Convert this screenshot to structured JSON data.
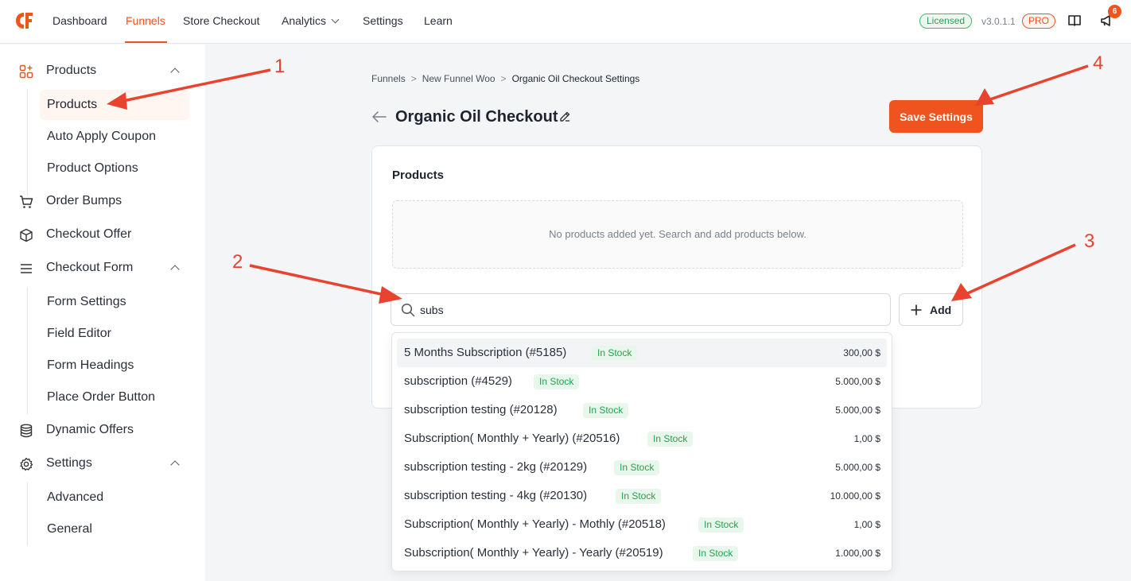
{
  "topnav": {
    "items": [
      {
        "label": "Dashboard"
      },
      {
        "label": "Funnels"
      },
      {
        "label": "Store Checkout"
      },
      {
        "label": "Analytics"
      },
      {
        "label": "Settings"
      },
      {
        "label": "Learn"
      }
    ],
    "licensed": "Licensed",
    "version": "v3.0.1.1",
    "pro": "PRO",
    "notifications": "6",
    "accent": "#f0541e"
  },
  "sidebar": {
    "groups": {
      "products": "Products",
      "order_bumps": "Order Bumps",
      "checkout_offer": "Checkout Offer",
      "checkout_form": "Checkout Form",
      "dynamic_offers": "Dynamic Offers",
      "settings": "Settings"
    },
    "products_sub": [
      "Products",
      "Auto Apply Coupon",
      "Product Options"
    ],
    "form_sub": [
      "Form Settings",
      "Field Editor",
      "Form Headings",
      "Place Order Button"
    ],
    "settings_sub": [
      "Advanced",
      "General"
    ]
  },
  "breadcrumb": [
    "Funnels",
    "New Funnel Woo",
    "Organic Oil Checkout Settings"
  ],
  "page_title": "Organic Oil Checkout",
  "save_label": "Save Settings",
  "card": {
    "title": "Products",
    "empty": "No products added yet. Search and add products below."
  },
  "search": {
    "value": "subs"
  },
  "add_label": "Add",
  "results": [
    {
      "name": "5 Months Subscription (#5185)",
      "stock": "In Stock",
      "price": "300,00 $"
    },
    {
      "name": "subscription (#4529)",
      "stock": "In Stock",
      "price": "5.000,00 $"
    },
    {
      "name": "subscription testing (#20128)",
      "stock": "In Stock",
      "price": "5.000,00 $"
    },
    {
      "name": "Subscription( Monthly + Yearly) (#20516)",
      "stock": "In Stock",
      "price": "1,00 $"
    },
    {
      "name": "subscription testing - 2kg (#20129)",
      "stock": "In Stock",
      "price": "5.000,00 $"
    },
    {
      "name": "subscription testing - 4kg (#20130)",
      "stock": "In Stock",
      "price": "10.000,00 $"
    },
    {
      "name": "Subscription( Monthly + Yearly) - Mothly (#20518)",
      "stock": "In Stock",
      "price": "1,00 $"
    },
    {
      "name": "Subscription( Monthly + Yearly) - Yearly (#20519)",
      "stock": "In Stock",
      "price": "1.000,00 $"
    }
  ],
  "annotations": [
    "1",
    "2",
    "3",
    "4"
  ],
  "annotation_color": "#e8432f"
}
